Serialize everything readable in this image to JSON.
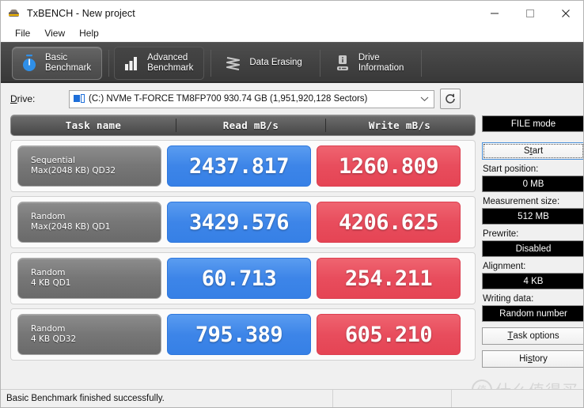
{
  "window": {
    "title": "TxBENCH - New project",
    "icon": "app-icon",
    "controls": {
      "minimize": "minimize-icon",
      "maximize": "maximize-icon",
      "close": "close-icon"
    }
  },
  "menu": {
    "items": [
      {
        "label": "File"
      },
      {
        "label": "View"
      },
      {
        "label": "Help"
      }
    ]
  },
  "tabs": [
    {
      "label": "Basic\nBenchmark",
      "icon": "stopwatch-icon",
      "state": "active"
    },
    {
      "label": "Advanced\nBenchmark",
      "icon": "bar-chart-icon",
      "state": "raised"
    },
    {
      "label": "Data Erasing",
      "icon": "shred-icon",
      "state": "plain"
    },
    {
      "label": "Drive\nInformation",
      "icon": "drive-info-icon",
      "state": "plain"
    }
  ],
  "drive": {
    "label": "Drive:",
    "label_accel": "D",
    "selected": "(C:) NVMe T-FORCE TM8FP700  930.74 GB (1,951,920,128 Sectors)",
    "icon": "drive-icon",
    "dropdown_icon": "chevron-down-icon",
    "refresh_icon": "refresh-icon"
  },
  "benchmark": {
    "headers": {
      "task": "Task name",
      "read": "Read mB/s",
      "write": "Write mB/s"
    },
    "rows": [
      {
        "task_line1": "Sequential",
        "task_line2": "Max(2048 KB) QD32",
        "read": "2437.817",
        "write": "1260.809"
      },
      {
        "task_line1": "Random",
        "task_line2": "Max(2048 KB) QD1",
        "read": "3429.576",
        "write": "4206.625"
      },
      {
        "task_line1": "Random",
        "task_line2": "4 KB QD1",
        "read": "60.713",
        "write": "254.211"
      },
      {
        "task_line1": "Random",
        "task_line2": "4 KB QD32",
        "read": "795.389",
        "write": "605.210"
      }
    ]
  },
  "sidebar": {
    "mode_button": "FILE mode",
    "start_button": "Start",
    "start_accel": "t",
    "fields": [
      {
        "label": "Start position:",
        "value": "0 MB"
      },
      {
        "label": "Measurement size:",
        "value": "512 MB"
      },
      {
        "label": "Prewrite:",
        "value": "Disabled"
      },
      {
        "label": "Alignment:",
        "value": "4 KB"
      },
      {
        "label": "Writing data:",
        "value": "Random number"
      }
    ],
    "task_options_button": "Task options",
    "task_options_accel": "T",
    "history_button": "History",
    "history_accel": "s"
  },
  "statusbar": {
    "message": "Basic Benchmark finished successfully.",
    "segment2": "",
    "segment3": ""
  },
  "watermark": {
    "mark": "值",
    "text": "什么值得买"
  },
  "colors": {
    "read_badge": "#3d85e8",
    "write_badge": "#e84d5d",
    "tabstrip": "#414141",
    "task_pill": "#777777",
    "window_bg": "#f0f0f0"
  }
}
